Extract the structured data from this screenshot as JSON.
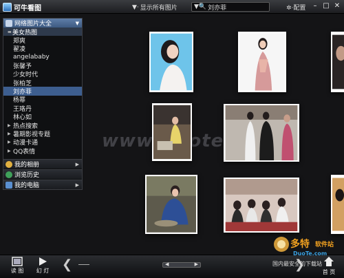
{
  "app": {
    "title": "可牛看图",
    "filter_label": "显示所有图片",
    "search_value": "刘亦菲",
    "config_label": "配置",
    "window_buttons": [
      "minimize-icon",
      "maximize-icon",
      "close-icon"
    ]
  },
  "sidebar": {
    "header": "网络图片大全",
    "open_category": "美女热图",
    "people": [
      "郑爽",
      "翟凌",
      "angelababy",
      "张馨予",
      "少女时代",
      "张柏芝",
      "刘亦菲",
      "杨幂",
      "王珞丹",
      "林心如"
    ],
    "selected": "刘亦菲",
    "categories": [
      "热点搜索",
      "暑期影视专题",
      "动漫卡通",
      "QQ表情"
    ],
    "nav": [
      "我的相册",
      "浏览历史",
      "我的电脑"
    ]
  },
  "watermark": "www.Duote.com",
  "bottom": {
    "view_label": "读 图",
    "slideshow_label": "幻 灯",
    "home_label": "首 页",
    "brand": "多特",
    "brand_sub": "软件站",
    "brand_slogan": "国内最安全的下载站",
    "brand_url": "DuoTe.com"
  },
  "colors": {
    "accent": "#3d5e8f",
    "header": "#4d6c96",
    "background": "#141416",
    "brand": "#f0a020"
  }
}
